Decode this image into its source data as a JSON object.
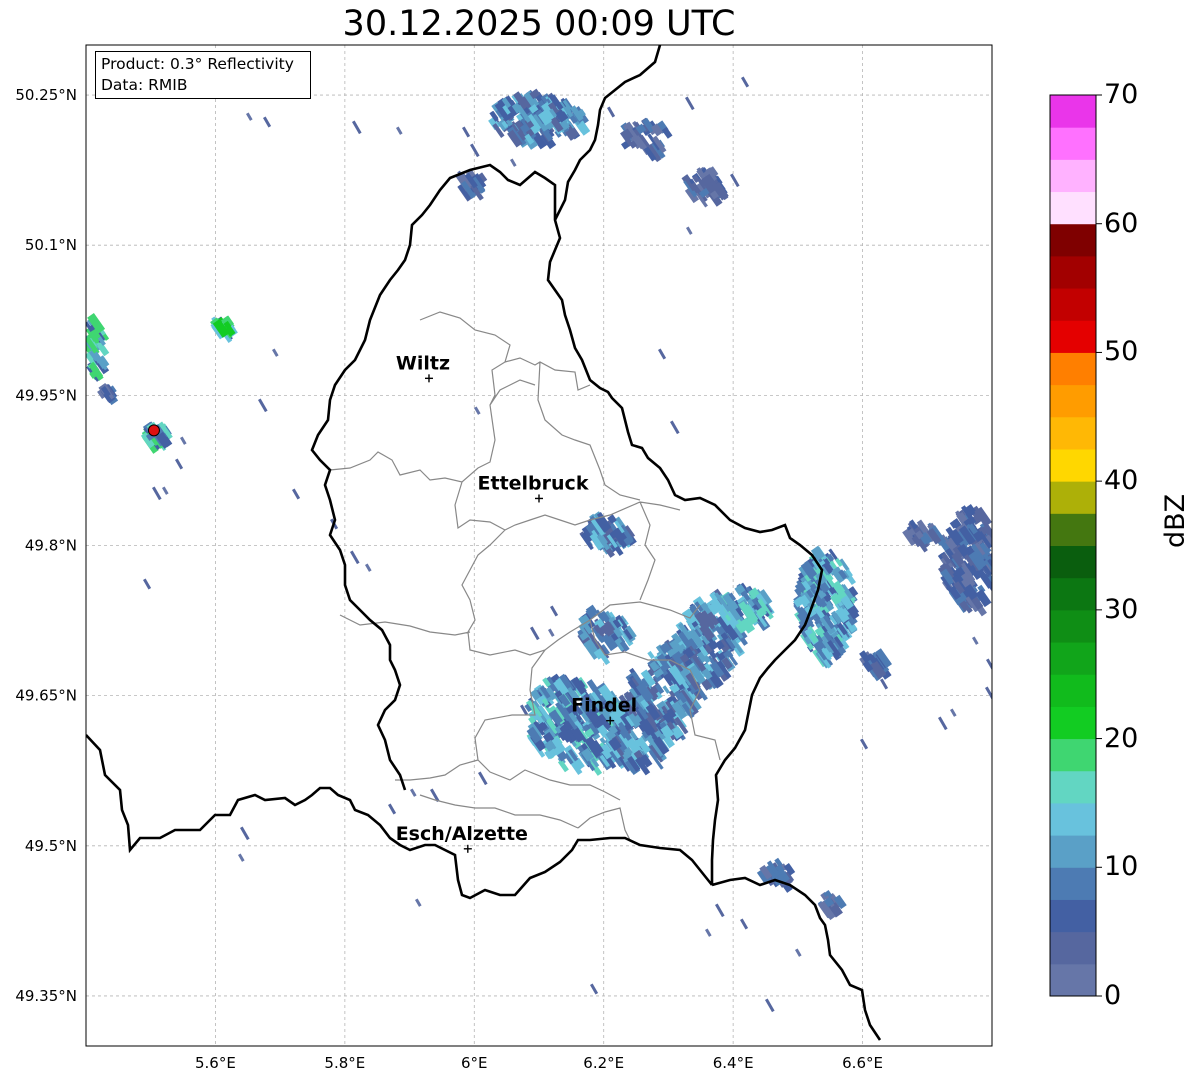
{
  "title": "30.12.2025 00:09 UTC",
  "info_box": {
    "product": "Product: 0.3° Reflectivity",
    "data": "Data: RMIB"
  },
  "map": {
    "lon_range": [
      5.4,
      6.8
    ],
    "lat_range": [
      49.3,
      50.3
    ],
    "lon_ticks": [
      {
        "value": 5.6,
        "label": "5.6°E"
      },
      {
        "value": 5.8,
        "label": "5.8°E"
      },
      {
        "value": 6.0,
        "label": "6°E"
      },
      {
        "value": 6.2,
        "label": "6.2°E"
      },
      {
        "value": 6.4,
        "label": "6.4°E"
      },
      {
        "value": 6.6,
        "label": "6.6°E"
      }
    ],
    "lat_ticks": [
      {
        "value": 50.25,
        "label": "50.25°N"
      },
      {
        "value": 50.1,
        "label": "50.1°N"
      },
      {
        "value": 49.95,
        "label": "49.95°N"
      },
      {
        "value": 49.8,
        "label": "49.8°N"
      },
      {
        "value": 49.65,
        "label": "49.65°N"
      },
      {
        "value": 49.5,
        "label": "49.5°N"
      },
      {
        "value": 49.35,
        "label": "49.35°N"
      }
    ],
    "cities": [
      {
        "name": "Wiltz",
        "lon": 5.93,
        "lat": 49.967
      },
      {
        "name": "Ettelbruck",
        "lon": 6.1,
        "lat": 49.847
      },
      {
        "name": "Findel",
        "lon": 6.21,
        "lat": 49.625
      },
      {
        "name": "Esch/Alzette",
        "lon": 5.99,
        "lat": 49.497
      }
    ],
    "radar_site": {
      "lon": 5.505,
      "lat": 49.915,
      "color": "#dd1111"
    }
  },
  "colorbar": {
    "label": "dBZ",
    "min": 0,
    "max": 70,
    "ticks": [
      "0",
      "10",
      "20",
      "30",
      "40",
      "50",
      "60",
      "70"
    ],
    "colors": [
      "#6676a8",
      "#56679f",
      "#4360a3",
      "#4d7bb3",
      "#5aa0c7",
      "#68c2dd",
      "#62d6c2",
      "#3fd671",
      "#12cc22",
      "#11bb1c",
      "#11a51a",
      "#0f8e15",
      "#0c7712",
      "#0a5e0e",
      "#447710",
      "#adb008",
      "#ffd700",
      "#ffb805",
      "#ff9c00",
      "#ff7f00",
      "#e40000",
      "#c20000",
      "#a20000",
      "#7f0000",
      "#ffe0ff",
      "#ffb2ff",
      "#ff71ff",
      "#ea35ea"
    ]
  }
}
